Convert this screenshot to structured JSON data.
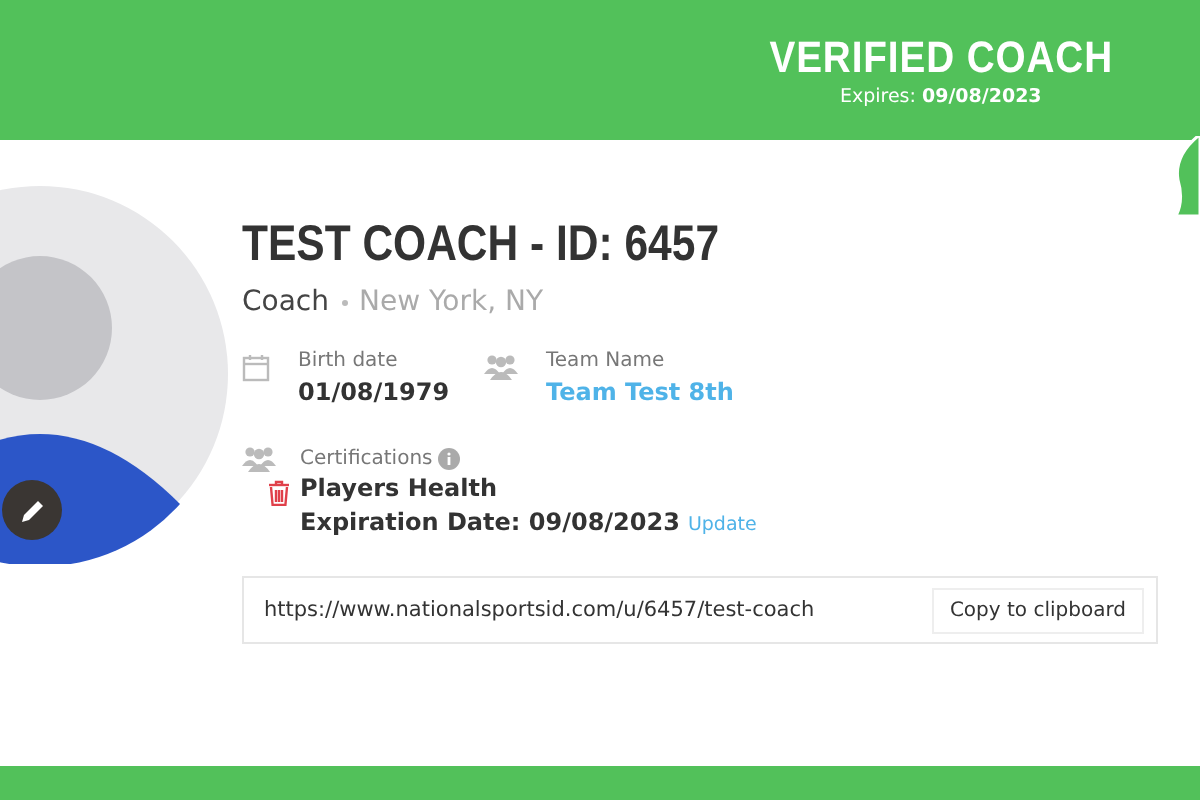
{
  "header": {
    "title": "VERIFIED COACH",
    "expires": "Expires: **09/08/2023**"
  },
  "profile": {
    "name": "TEST COACH - ID: 6457",
    "role": "Coach",
    "location": "New York, NY"
  },
  "fields": [
    {
      "kind": "date",
      "label": "Birth date",
      "value": "01/08/1979"
    },
    {
      "kind": "team",
      "label": "Team Name",
      "value": "Team Test 8th"
    }
  ],
  "certifications": {
    "label": "Certifications",
    "items": [
      {
        "name": "Players Health",
        "expiration": "Expiration Date: 09/08/2023",
        "action": "Update"
      }
    ]
  },
  "share": {
    "url": "https://www.nationalsportsid.com/u/6457/test-coach",
    "button": "Copy to clipboard"
  }
}
